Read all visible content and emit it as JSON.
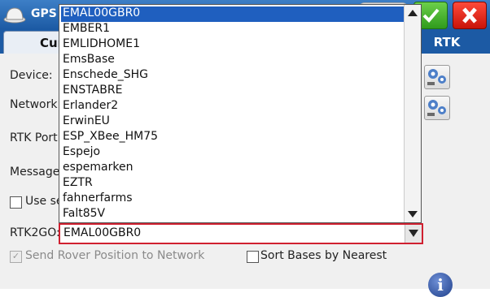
{
  "window": {
    "title": "GPS I",
    "ok_icon": "checkmark-icon",
    "close_icon": "close-icon"
  },
  "tabs": [
    {
      "label": "Cur"
    },
    {
      "label": "RTK"
    }
  ],
  "labels": {
    "device": "Device:",
    "network": "Network:",
    "rtk_port": "RTK Port:",
    "message": "Message",
    "use_se": "Use se",
    "rtk2go": "RTK2GO:",
    "send_rover": "Send Rover Position to Network",
    "sort_bases": "Sort Bases by Nearest"
  },
  "rtk2go": {
    "value": "EMAL00GBR0"
  },
  "dropdown": {
    "selected_index": 0,
    "items": [
      "EMAL00GBR0",
      "EMBER1",
      "EMLIDHOME1",
      "EmsBase",
      "Enschede_SHG",
      "ENSTABRE",
      "Erlander2",
      "ErwinEU",
      "ESP_XBee_HM75",
      "Espejo",
      "espemarken",
      "EZTR",
      "fahnerfarms",
      "Falt85V"
    ]
  },
  "checkboxes": {
    "send_rover_checked": true,
    "sort_bases_checked": false,
    "use_se_checked": false
  }
}
